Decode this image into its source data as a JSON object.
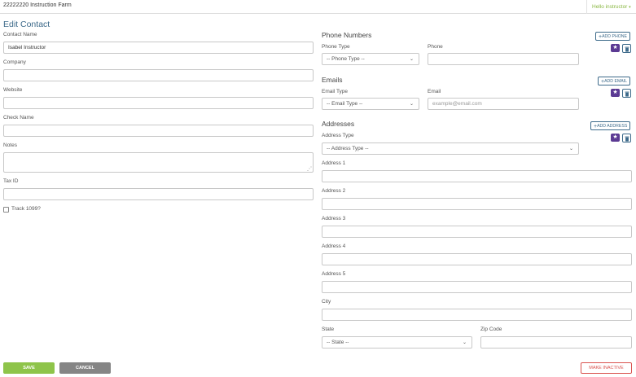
{
  "header": {
    "farm_name": "22222220 Instruction Farm",
    "user_menu": "Hello instructor"
  },
  "page_title": "Edit Contact",
  "contact": {
    "contact_name_label": "Contact Name",
    "contact_name_value": "Isabel Instructor",
    "company_label": "Company",
    "company_value": "",
    "website_label": "Website",
    "website_value": "",
    "check_name_label": "Check Name",
    "check_name_value": "",
    "notes_label": "Notes",
    "notes_value": "",
    "tax_id_label": "Tax ID",
    "tax_id_value": "",
    "track_1099_label": "Track 1099?",
    "track_1099_checked": false
  },
  "phones": {
    "title": "Phone Numbers",
    "add_label": "ADD PHONE",
    "type_label": "Phone Type",
    "type_value": "-- Phone Type --",
    "number_label": "Phone",
    "number_value": ""
  },
  "emails": {
    "title": "Emails",
    "add_label": "ADD EMAIL",
    "type_label": "Email Type",
    "type_value": "-- Email Type --",
    "email_label": "Email",
    "email_placeholder": "example@email.com"
  },
  "addresses": {
    "title": "Addresses",
    "add_label": "ADD ADDRESS",
    "type_label": "Address Type",
    "type_value": "-- Address Type --",
    "address1_label": "Address 1",
    "address2_label": "Address 2",
    "address3_label": "Address 3",
    "address4_label": "Address 4",
    "address5_label": "Address 5",
    "city_label": "City",
    "state_label": "State",
    "state_value": "-- State --",
    "zip_label": "Zip Code"
  },
  "actions": {
    "save_label": "SAVE",
    "cancel_label": "CANCEL",
    "make_inactive_label": "MAKE INACTIVE"
  },
  "colors": {
    "title_blue": "#3d6a8a",
    "save_green": "#8ec44a",
    "cancel_gray": "#858585",
    "danger_red": "#d9534f",
    "star_purple": "#5b3a93",
    "user_green": "#8ab843"
  },
  "icons": {
    "star": "star-icon",
    "trash": "trash-icon",
    "plus": "plus-icon",
    "caret": "caret-down-icon",
    "chevron": "chevron-down-icon",
    "resize": "resize-grip-icon"
  }
}
